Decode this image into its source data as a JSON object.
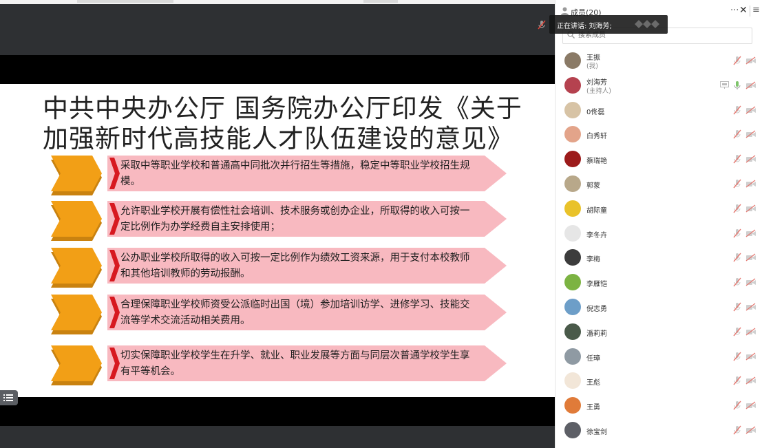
{
  "slide": {
    "title": "中共中央办公厅 国务院办公厅印发《关于\n加强新时代高技能人才队伍建设的意见》",
    "items": [
      "采取中等职业学校和普通高中同批次并行招生等措施，稳定中等职业学校招生规模。",
      "允许职业学校开展有偿性社会培训、技术服务或创办企业，所取得的收入可按一定比例作为办学经费自主安排使用；",
      "公办职业学校所取得的收入可按一定比例作为绩效工资来源，用于支付本校教师和其他培训教师的劳动报酬。",
      "合理保障职业学校师资受公派临时出国（境）参加培训访学、进修学习、技能交流等学术交流活动相关费用。",
      "切实保障职业学校学生在升学、就业、职业发展等方面与同层次普通学校学生享有平等机会。"
    ],
    "colors": {
      "chevron": "#f29f16",
      "chevron_shadow": "#c98210",
      "banner": "#f8b9c0",
      "accent": "#d71920"
    }
  },
  "panel": {
    "title": "成员(20)",
    "more_label": "···",
    "close_label": "✕",
    "menu_label": "≡",
    "search_placeholder": "搜索成员",
    "speaking_label": "正在讲话: 刘海芳;",
    "members": [
      {
        "name": "王振",
        "role": "(我)",
        "avatar_color": "#8a7a66"
      },
      {
        "name": "刘海芳",
        "role": "(主持人)",
        "avatar_color": "#b5424f"
      },
      {
        "name": "0佟磊",
        "role": "",
        "avatar_color": "#d7c3a5"
      },
      {
        "name": "白秀轩",
        "role": "",
        "avatar_color": "#e3a48a"
      },
      {
        "name": "蔡瑞艳",
        "role": "",
        "avatar_color": "#9c1b1b"
      },
      {
        "name": "郭蒙",
        "role": "",
        "avatar_color": "#b8a88a"
      },
      {
        "name": "胡际童",
        "role": "",
        "avatar_color": "#e9c22a"
      },
      {
        "name": "李冬卉",
        "role": "",
        "avatar_color": "#e6e6e6"
      },
      {
        "name": "李梅",
        "role": "",
        "avatar_color": "#3c3c3c"
      },
      {
        "name": "李雁铠",
        "role": "",
        "avatar_color": "#7cb342"
      },
      {
        "name": "倪志勇",
        "role": "",
        "avatar_color": "#6d9ec8"
      },
      {
        "name": "潘莉莉",
        "role": "",
        "avatar_color": "#4a5a4a"
      },
      {
        "name": "任璋",
        "role": "",
        "avatar_color": "#8f9aa3"
      },
      {
        "name": "王彪",
        "role": "",
        "avatar_color": "#f2e6d8"
      },
      {
        "name": "王勇",
        "role": "",
        "avatar_color": "#e07b39"
      },
      {
        "name": "徐宝剑",
        "role": "",
        "avatar_color": "#5d5f66"
      }
    ]
  }
}
